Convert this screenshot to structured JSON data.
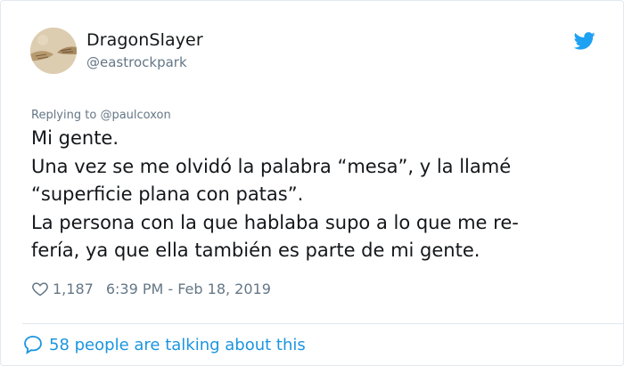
{
  "user": {
    "name": "DragonSlayer",
    "handle": "@eastrockpark"
  },
  "tweet": {
    "replying_prefix": "Replying to ",
    "replying_mention": "@paulcoxon",
    "lines": [
      "Mi gente.",
      "Una vez se me olvidó la palabra “mesa”, y la  llamé",
      "“superficie plana con patas”.",
      "La persona con la que hablaba supo a lo que me re-",
      "fería, ya que ella también es parte de mi gente."
    ],
    "likes": "1,187",
    "timestamp": "6:39 PM - Feb 18, 2019"
  },
  "footer": {
    "talking_text": "58 people are talking about this"
  },
  "icons": {
    "brand": "twitter-bird-icon",
    "like": "heart-icon",
    "comment": "comment-bubble-icon"
  },
  "colors": {
    "accent": "#1da1f2",
    "link": "#1b95e0",
    "muted": "#657786",
    "text": "#14171a",
    "border": "#e1e8ed"
  }
}
